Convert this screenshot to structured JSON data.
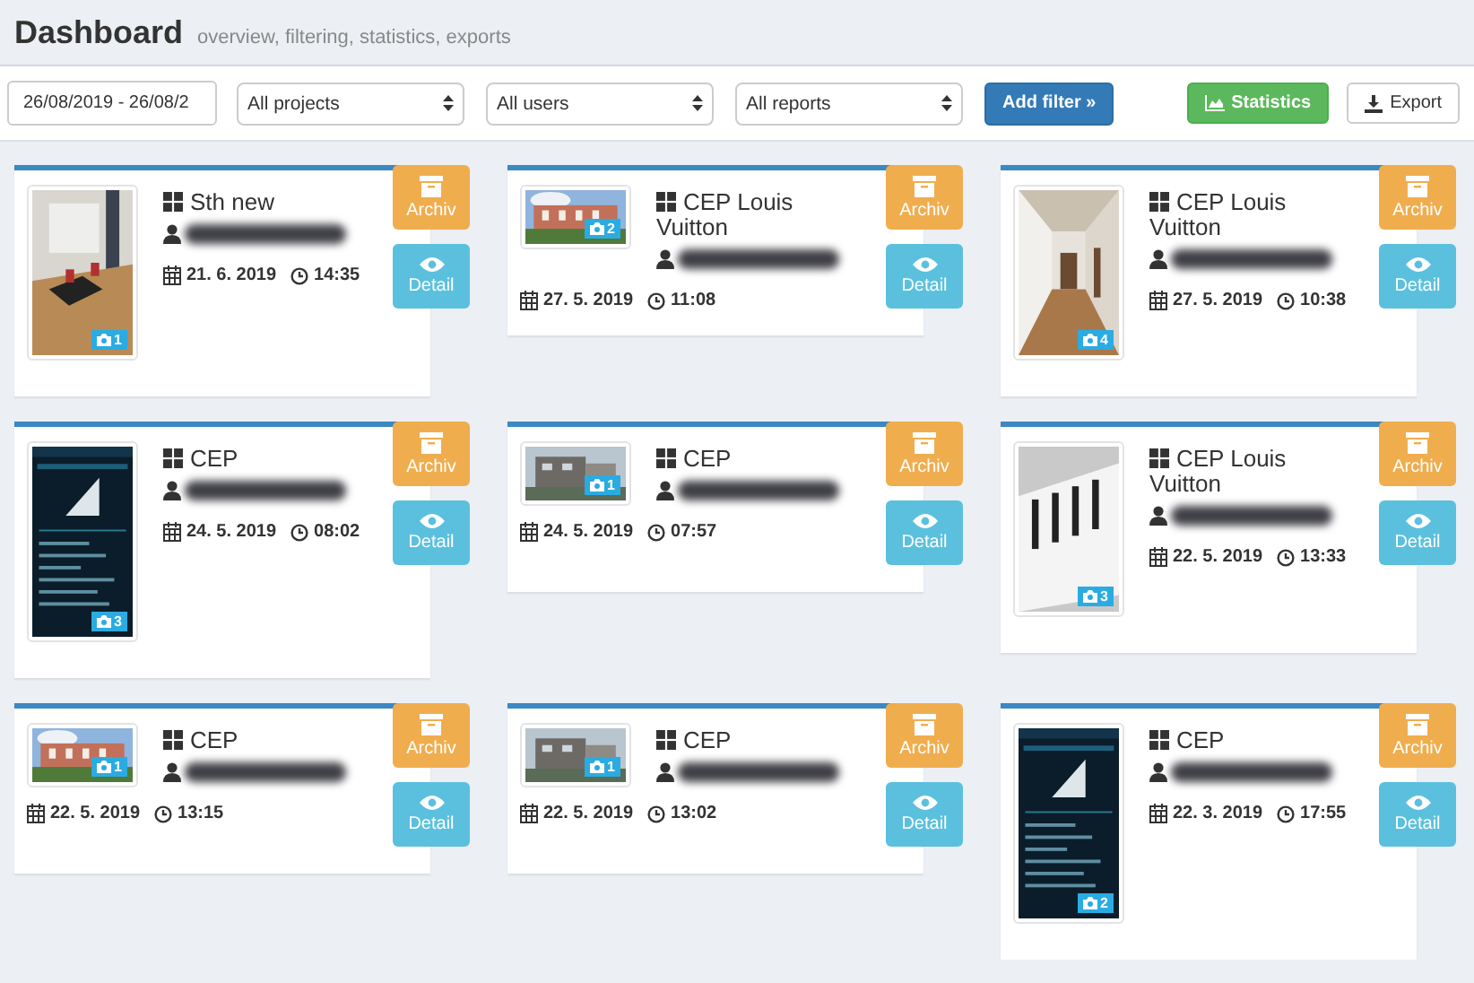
{
  "header": {
    "title": "Dashboard",
    "subtitle": "overview, filtering, statistics, exports"
  },
  "toolbar": {
    "date_range": "26/08/2019 - 26/08/2",
    "selects": [
      "All projects",
      "All users",
      "All reports"
    ],
    "add_filter": "Add filter »",
    "statistics": "Statistics",
    "export": "Export"
  },
  "reports": [
    {
      "title": "Sth new",
      "date": "21. 6. 2019",
      "time": "14:35",
      "photos": "1",
      "kind": "portrait",
      "archive_label": "Archiv",
      "detail_label": "Detail"
    },
    {
      "title": "CEP Louis Vuitton",
      "date": "27. 5. 2019",
      "time": "11:08",
      "photos": "2",
      "kind": "landscape",
      "archive_label": "Archiv",
      "detail_label": "Detail"
    },
    {
      "title": "CEP Louis Vuitton",
      "date": "27. 5. 2019",
      "time": "10:38",
      "photos": "4",
      "kind": "portrait",
      "archive_label": "Archiv",
      "detail_label": "Detail"
    },
    {
      "title": "CEP",
      "date": "24. 5. 2019",
      "time": "08:02",
      "photos": "3",
      "kind": "tall",
      "archive_label": "Archiv",
      "detail_label": "Detail"
    },
    {
      "title": "CEP",
      "date": "24. 5. 2019",
      "time": "07:57",
      "photos": "1",
      "kind": "landscape",
      "archive_label": "Archiv",
      "detail_label": "Detail"
    },
    {
      "title": "CEP Louis Vuitton",
      "date": "22. 5. 2019",
      "time": "13:33",
      "photos": "3",
      "kind": "portrait",
      "archive_label": "Archiv",
      "detail_label": "Detail"
    },
    {
      "title": "CEP",
      "date": "22. 5. 2019",
      "time": "13:15",
      "photos": "1",
      "kind": "landscape",
      "archive_label": "Archiv",
      "detail_label": "Detail"
    },
    {
      "title": "CEP",
      "date": "22. 5. 2019",
      "time": "13:02",
      "photos": "1",
      "kind": "landscape",
      "archive_label": "Archiv",
      "detail_label": "Detail"
    },
    {
      "title": "CEP",
      "date": "22. 3. 2019",
      "time": "17:55",
      "photos": "2",
      "kind": "tall",
      "archive_label": "Archiv",
      "detail_label": "Detail"
    }
  ]
}
